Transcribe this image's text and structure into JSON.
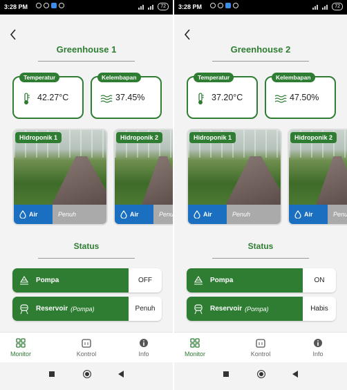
{
  "screens": [
    {
      "status_bar": {
        "time": "3:28 PM",
        "battery": "72"
      },
      "title": "Greenhouse 1",
      "sensors": {
        "temp_label": "Temperatur",
        "temp_value": "42.27°C",
        "humidity_label": "Kelembapan",
        "humidity_value": "37.45%"
      },
      "hydroponics": [
        {
          "label": "Hidroponik 1",
          "water_label": "Air",
          "water_status": "Penuh"
        },
        {
          "label": "Hidroponik 2",
          "water_label": "Air",
          "water_status": "Penuh"
        }
      ],
      "status_title": "Status",
      "pump": {
        "label": "Pompa",
        "value": "OFF"
      },
      "reservoir": {
        "label": "Reservoir",
        "sub": "(Pompa)",
        "value": "Penuh"
      },
      "nav": {
        "monitor": "Monitor",
        "kontrol": "Kontrol",
        "info": "Info"
      }
    },
    {
      "status_bar": {
        "time": "3:28 PM",
        "battery": "72"
      },
      "title": "Greenhouse 2",
      "sensors": {
        "temp_label": "Temperatur",
        "temp_value": "37.20°C",
        "humidity_label": "Kelembapan",
        "humidity_value": "47.50%"
      },
      "hydroponics": [
        {
          "label": "Hidroponik 1",
          "water_label": "Air",
          "water_status": "Penuh"
        },
        {
          "label": "Hidroponik 2",
          "water_label": "Air",
          "water_status": "Penuh"
        }
      ],
      "status_title": "Status",
      "pump": {
        "label": "Pompa",
        "value": "ON"
      },
      "reservoir": {
        "label": "Reservoir",
        "sub": "(Pompa)",
        "value": "Habis"
      },
      "nav": {
        "monitor": "Monitor",
        "kontrol": "Kontrol",
        "info": "Info"
      }
    }
  ],
  "colors": {
    "primary_green": "#2e7d32",
    "water_blue": "#1a6fc1"
  },
  "icons": [
    "back-arrow-icon",
    "thermometer-icon",
    "humidity-icon",
    "water-drop-icon",
    "pump-icon",
    "reservoir-icon",
    "monitor-grid-icon",
    "kontrol-icon",
    "info-icon"
  ]
}
